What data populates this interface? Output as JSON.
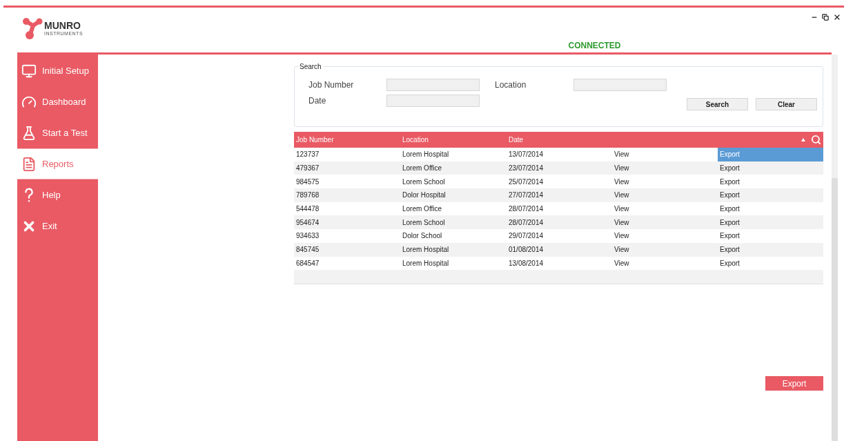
{
  "logo": {
    "name": "MUNRO",
    "tagline": "INSTRUMENTS"
  },
  "status": "CONNECTED",
  "sidebar": {
    "items": [
      {
        "label": "Initial Setup",
        "selected": false
      },
      {
        "label": "Dashboard",
        "selected": false
      },
      {
        "label": "Start a Test",
        "selected": false
      },
      {
        "label": "Reports",
        "selected": true
      },
      {
        "label": "Help",
        "selected": false
      },
      {
        "label": "Exit",
        "selected": false
      }
    ]
  },
  "search": {
    "title": "Search",
    "fields": [
      {
        "label": "Job Number"
      },
      {
        "label": "Location"
      },
      {
        "label": "Date"
      }
    ],
    "buttons": [
      "Search",
      "Clear"
    ]
  },
  "table": {
    "columns": [
      "Job Number",
      "Location",
      "Date"
    ],
    "rows": [
      {
        "job_number": "123737",
        "location": "Lorem Hospital",
        "date": "13/07/2014",
        "view": "View",
        "export": "Export",
        "selected": true
      },
      {
        "job_number": "479367",
        "location": "Lorem Office",
        "date": "23/07/2014",
        "view": "View",
        "export": "Export",
        "selected": false
      },
      {
        "job_number": "984575",
        "location": "Lorem School",
        "date": "25/07/2014",
        "view": "View",
        "export": "Export",
        "selected": false
      },
      {
        "job_number": "789768",
        "location": "Dolor Hospital",
        "date": "27/07/2014",
        "view": "View",
        "export": "Export",
        "selected": false
      },
      {
        "job_number": "544478",
        "location": "Lorem Office",
        "date": "28/07/2014",
        "view": "View",
        "export": "Export",
        "selected": false
      },
      {
        "job_number": "954674",
        "location": "Lorem School",
        "date": "28/07/2014",
        "view": "View",
        "export": "Export",
        "selected": false
      },
      {
        "job_number": "934633",
        "location": "Dolor School",
        "date": "29/07/2014",
        "view": "View",
        "export": "Export",
        "selected": false
      },
      {
        "job_number": "845745",
        "location": "Lorem Hospital",
        "date": "01/08/2014",
        "view": "View",
        "export": "Export",
        "selected": false
      },
      {
        "job_number": "684547",
        "location": "Lorem Hospital",
        "date": "13/08/2014",
        "view": "View",
        "export": "Export",
        "selected": false
      }
    ]
  },
  "export_button": "Export"
}
